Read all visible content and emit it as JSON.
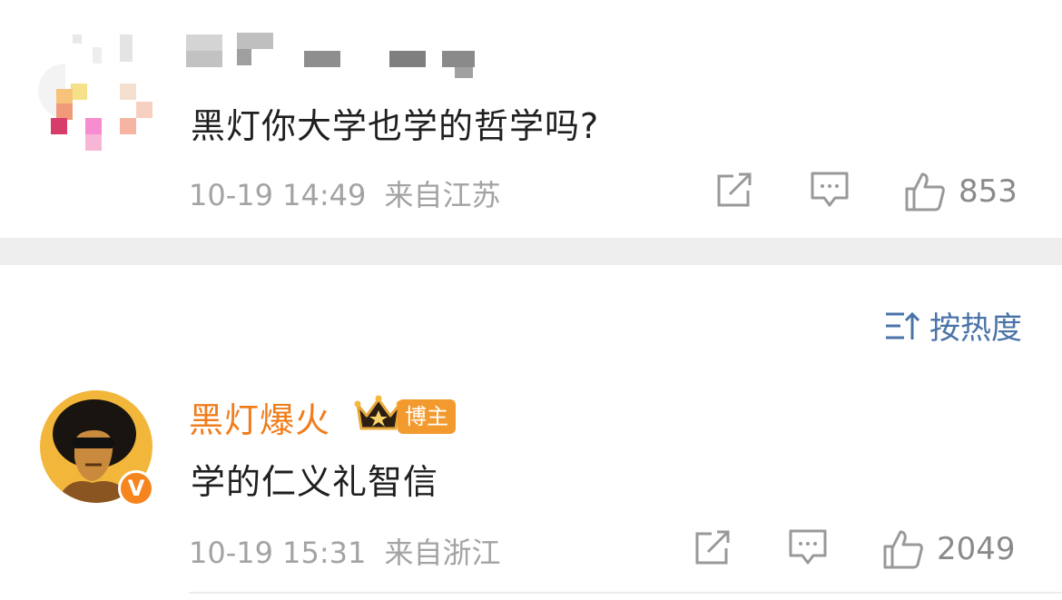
{
  "comments": [
    {
      "username": "",
      "text": "黑灯你大学也学的哲学吗?",
      "timestamp": "10-19 14:49",
      "location": "来自江苏",
      "like_count": "853",
      "avatar_icon": "blurred-avatar-icon"
    },
    {
      "username": "黑灯爆火",
      "badge_label": "博主",
      "text": "学的仁义礼智信",
      "timestamp": "10-19 15:31",
      "location": "来自浙江",
      "like_count": "2049",
      "avatar_icon": "afro-man-avatar",
      "verified_mark": "V"
    }
  ],
  "sort": {
    "label": "按热度"
  },
  "colors": {
    "author_orange": "#f07d1c",
    "link_blue": "#4a73a8",
    "meta_gray": "#a3a3a3",
    "avatar_yellow": "#f2b63b"
  }
}
